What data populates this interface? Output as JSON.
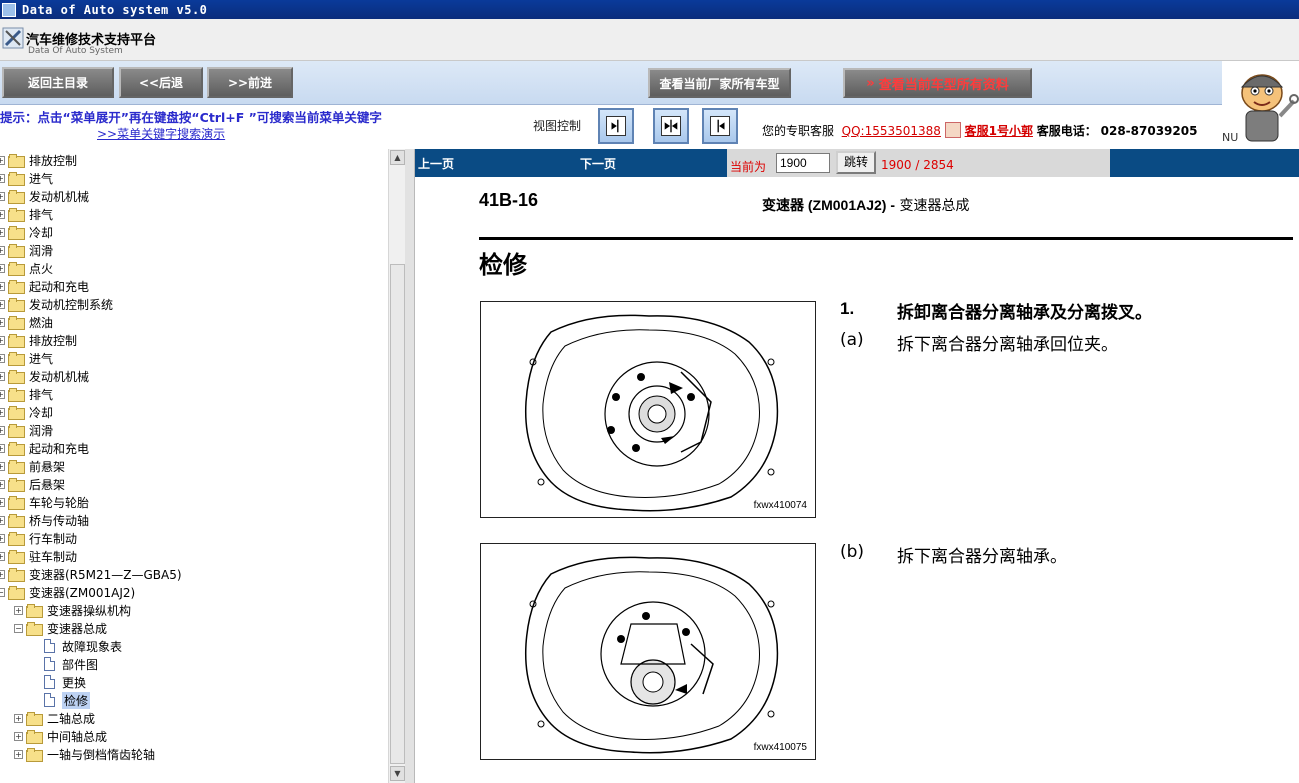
{
  "window": {
    "title": "Data of Auto system v5.0"
  },
  "app": {
    "name": "汽车维修技术支持平台",
    "subtitle": "Data Of Auto System"
  },
  "nav": {
    "home": "返回主目录",
    "back": "<<后退",
    "forward": ">>前进",
    "all_models": "查看当前厂家所有车型",
    "all_data": "查看当前车型所有资料"
  },
  "tip": {
    "text": "提示：点击“菜单展开”再在键盘按“Ctrl+F ”可搜索当前菜单关键字",
    "link": ">>菜单关键字搜索演示"
  },
  "view_control": {
    "label": "视图控制"
  },
  "service": {
    "label": "您的专职客服",
    "qq": "QQ:1553501388",
    "name": "客服1号小郭",
    "phone_label": "客服电话：",
    "phone": "028-87039205"
  },
  "nu": "NU",
  "tree": [
    {
      "label": "排放控制",
      "level": 0,
      "type": "folder",
      "toggle": "+"
    },
    {
      "label": "进气",
      "level": 0,
      "type": "folder",
      "toggle": "+"
    },
    {
      "label": "发动机机械",
      "level": 0,
      "type": "folder",
      "toggle": "+"
    },
    {
      "label": "排气",
      "level": 0,
      "type": "folder",
      "toggle": "+"
    },
    {
      "label": "冷却",
      "level": 0,
      "type": "folder",
      "toggle": "+"
    },
    {
      "label": "润滑",
      "level": 0,
      "type": "folder",
      "toggle": "+"
    },
    {
      "label": "点火",
      "level": 0,
      "type": "folder",
      "toggle": "+"
    },
    {
      "label": "起动和充电",
      "level": 0,
      "type": "folder",
      "toggle": "+"
    },
    {
      "label": "发动机控制系统",
      "level": 0,
      "type": "folder",
      "toggle": "+"
    },
    {
      "label": "燃油",
      "level": 0,
      "type": "folder",
      "toggle": "+"
    },
    {
      "label": "排放控制",
      "level": 0,
      "type": "folder",
      "toggle": "+"
    },
    {
      "label": "进气",
      "level": 0,
      "type": "folder",
      "toggle": "+"
    },
    {
      "label": "发动机机械",
      "level": 0,
      "type": "folder",
      "toggle": "+"
    },
    {
      "label": "排气",
      "level": 0,
      "type": "folder",
      "toggle": "+"
    },
    {
      "label": "冷却",
      "level": 0,
      "type": "folder",
      "toggle": "+"
    },
    {
      "label": "润滑",
      "level": 0,
      "type": "folder",
      "toggle": "+"
    },
    {
      "label": "起动和充电",
      "level": 0,
      "type": "folder",
      "toggle": "+"
    },
    {
      "label": "前悬架",
      "level": 0,
      "type": "folder",
      "toggle": "+"
    },
    {
      "label": "后悬架",
      "level": 0,
      "type": "folder",
      "toggle": "+"
    },
    {
      "label": "车轮与轮胎",
      "level": 0,
      "type": "folder",
      "toggle": "+"
    },
    {
      "label": "桥与传动轴",
      "level": 0,
      "type": "folder",
      "toggle": "+"
    },
    {
      "label": "行车制动",
      "level": 0,
      "type": "folder",
      "toggle": "+"
    },
    {
      "label": "驻车制动",
      "level": 0,
      "type": "folder",
      "toggle": "+"
    },
    {
      "label": "变速器(R5M21—Z—GBA5)",
      "level": 0,
      "type": "folder",
      "toggle": "+"
    },
    {
      "label": "变速器(ZM001AJ2)",
      "level": 0,
      "type": "folder",
      "toggle": "−"
    },
    {
      "label": "变速器操纵机构",
      "level": 1,
      "type": "folder",
      "toggle": "+"
    },
    {
      "label": "变速器总成",
      "level": 1,
      "type": "folder",
      "toggle": "−"
    },
    {
      "label": "故障现象表",
      "level": 2,
      "type": "doc"
    },
    {
      "label": "部件图",
      "level": 2,
      "type": "doc"
    },
    {
      "label": "更换",
      "level": 2,
      "type": "doc"
    },
    {
      "label": "检修",
      "level": 2,
      "type": "doc",
      "selected": true
    },
    {
      "label": "二轴总成",
      "level": 1,
      "type": "folder",
      "toggle": "+"
    },
    {
      "label": "中间轴总成",
      "level": 1,
      "type": "folder",
      "toggle": "+"
    },
    {
      "label": "一轴与倒档惰齿轮轴",
      "level": 1,
      "type": "folder",
      "toggle": "+"
    }
  ],
  "pager": {
    "prev": "上一页",
    "next": "下一页",
    "current_label": "当前为",
    "current_value": "1900",
    "jump": "跳转",
    "total": "1900 / 2854"
  },
  "doc": {
    "page_number": "41B-16",
    "section_bold": "变速器 (ZM001AJ2) -",
    "section_rest": " 变速器总成",
    "heading": "检修",
    "step1_num": "1.",
    "step1_text": "拆卸离合器分离轴承及分离拨叉。",
    "step_a_num": "(a)",
    "step_a_text": "拆下离合器分离轴承回位夹。",
    "step_b_num": "(b)",
    "step_b_text": "拆下离合器分离轴承。",
    "fig1_code": "fxwx410074",
    "fig2_code": "fxwx410075"
  },
  "colors": {
    "titlebar": "#0b2d7c",
    "pagebar": "#0a4b84",
    "tip": "#2a2acc",
    "red": "#d40000"
  }
}
